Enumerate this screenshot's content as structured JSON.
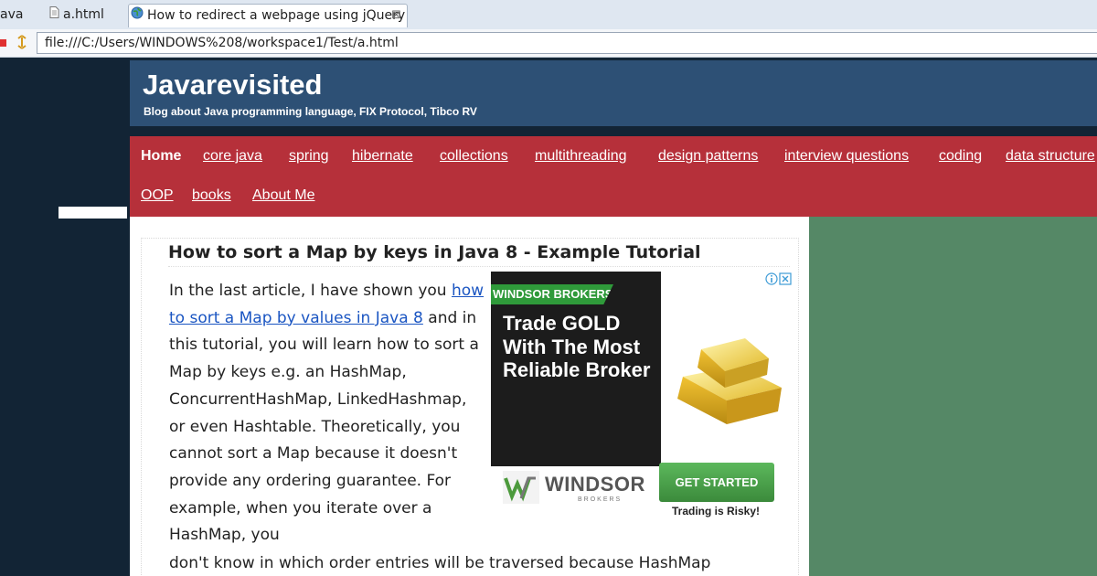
{
  "browser": {
    "tabs": [
      {
        "label": "ava",
        "active": false
      },
      {
        "label": "a.html",
        "active": false
      },
      {
        "label": "How to redirect a webpage using jQuery",
        "active": true
      }
    ],
    "close_glyph": "⊠",
    "url": "file:///C:/Users/WINDOWS%208/workspace1/Test/a.html"
  },
  "site": {
    "title": "Javarevisited",
    "description": "Blog about Java programming language, FIX Protocol, Tibco RV"
  },
  "nav": {
    "items": [
      "Home",
      "core java",
      "spring",
      "hibernate",
      "collections",
      "multithreading",
      "design patterns",
      "interview questions",
      "coding",
      "data structure",
      "OOP",
      "books",
      "About Me"
    ]
  },
  "post": {
    "title": "How to sort a Map by keys in Java 8 - Example Tutorial",
    "intro_before_link": "In the last article, I have shown you ",
    "link_text": "how to sort a Map by values in Java 8",
    "intro_after_link": " and in this tutorial, you will learn how to sort a Map by keys e.g. an HashMap, ConcurrentHashMap, LinkedHashmap, or even Hashtable. Theoretically, you cannot sort a Map because it doesn't provide any ordering guarantee. For example, when you iterate over a HashMap, you",
    "last_line": "don't know in which order entries will be traversed because HashMap"
  },
  "ad": {
    "brand_tag": "WINDSOR BROKERS",
    "headline": "Trade GOLD With The Most Reliable Broker",
    "logo_word": "WINDSOR",
    "logo_sub": "BROKERS",
    "cta": "GET STARTED",
    "risk": "Trading is Risky!"
  },
  "colors": {
    "header": "#2d5075",
    "nav": "#b6303a",
    "page_bg": "#122435",
    "sidebar": "#558866",
    "link": "#1a55c2",
    "cta_green": "#4cae4c"
  },
  "icons": [
    "file-icon",
    "globe-icon",
    "close-tab-icon",
    "stop-icon",
    "refresh-icon",
    "ad-info-icon",
    "ad-close-icon",
    "gold-bars-icon",
    "windsor-logo-icon"
  ]
}
